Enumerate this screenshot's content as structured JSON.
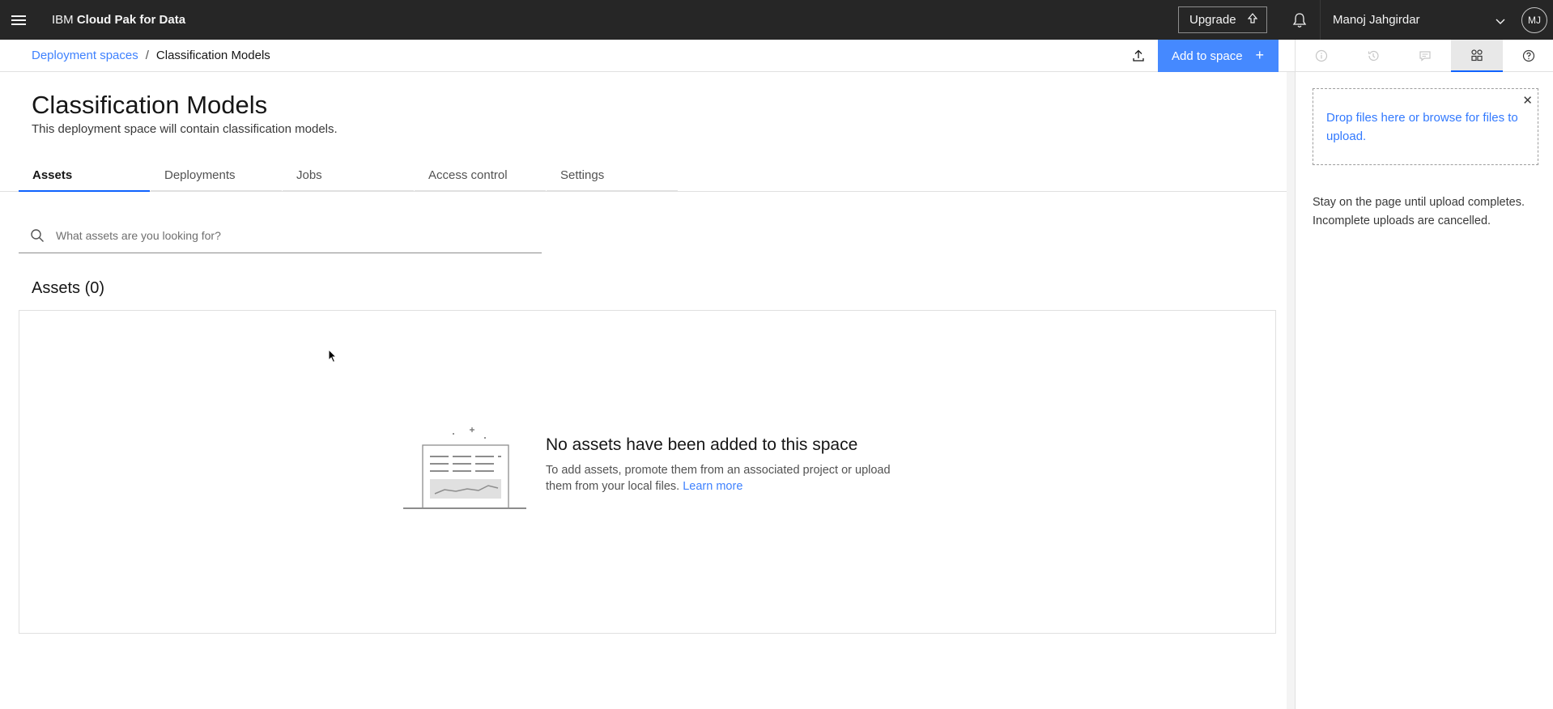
{
  "header": {
    "brand_prefix": "IBM",
    "brand_name": "Cloud Pak for Data",
    "upgrade_label": "Upgrade",
    "user_name": "Manoj Jahgirdar",
    "avatar_initials": "MJ"
  },
  "breadcrumb": {
    "parent": "Deployment spaces",
    "separator": "/",
    "current": "Classification Models"
  },
  "toolbar": {
    "add_label": "Add to space",
    "add_icon": "+"
  },
  "page": {
    "title": "Classification Models",
    "description": "This deployment space will contain classification models."
  },
  "tabs": [
    {
      "label": "Assets",
      "active": true
    },
    {
      "label": "Deployments",
      "active": false
    },
    {
      "label": "Jobs",
      "active": false
    },
    {
      "label": "Access control",
      "active": false
    },
    {
      "label": "Settings",
      "active": false
    }
  ],
  "search": {
    "placeholder": "What assets are you looking for?",
    "value": ""
  },
  "assets": {
    "heading": "Assets (0)",
    "empty_title": "No assets have been added to this space",
    "empty_text": "To add assets, promote them from an associated project or upload them from your local files.",
    "learn_more": "Learn more"
  },
  "right_panel": {
    "icons": [
      "info-icon",
      "history-icon",
      "comment-icon",
      "data-upload-icon",
      "help-icon"
    ],
    "active_icon": "data-upload-icon",
    "dropzone_text": "Drop files here or browse for files to upload.",
    "close_glyph": "✕",
    "note": "Stay on the page until upload completes. Incomplete uploads are cancelled."
  },
  "colors": {
    "header_bg": "#262626",
    "accent": "#0f62fe",
    "primary_button": "#4589ff"
  }
}
